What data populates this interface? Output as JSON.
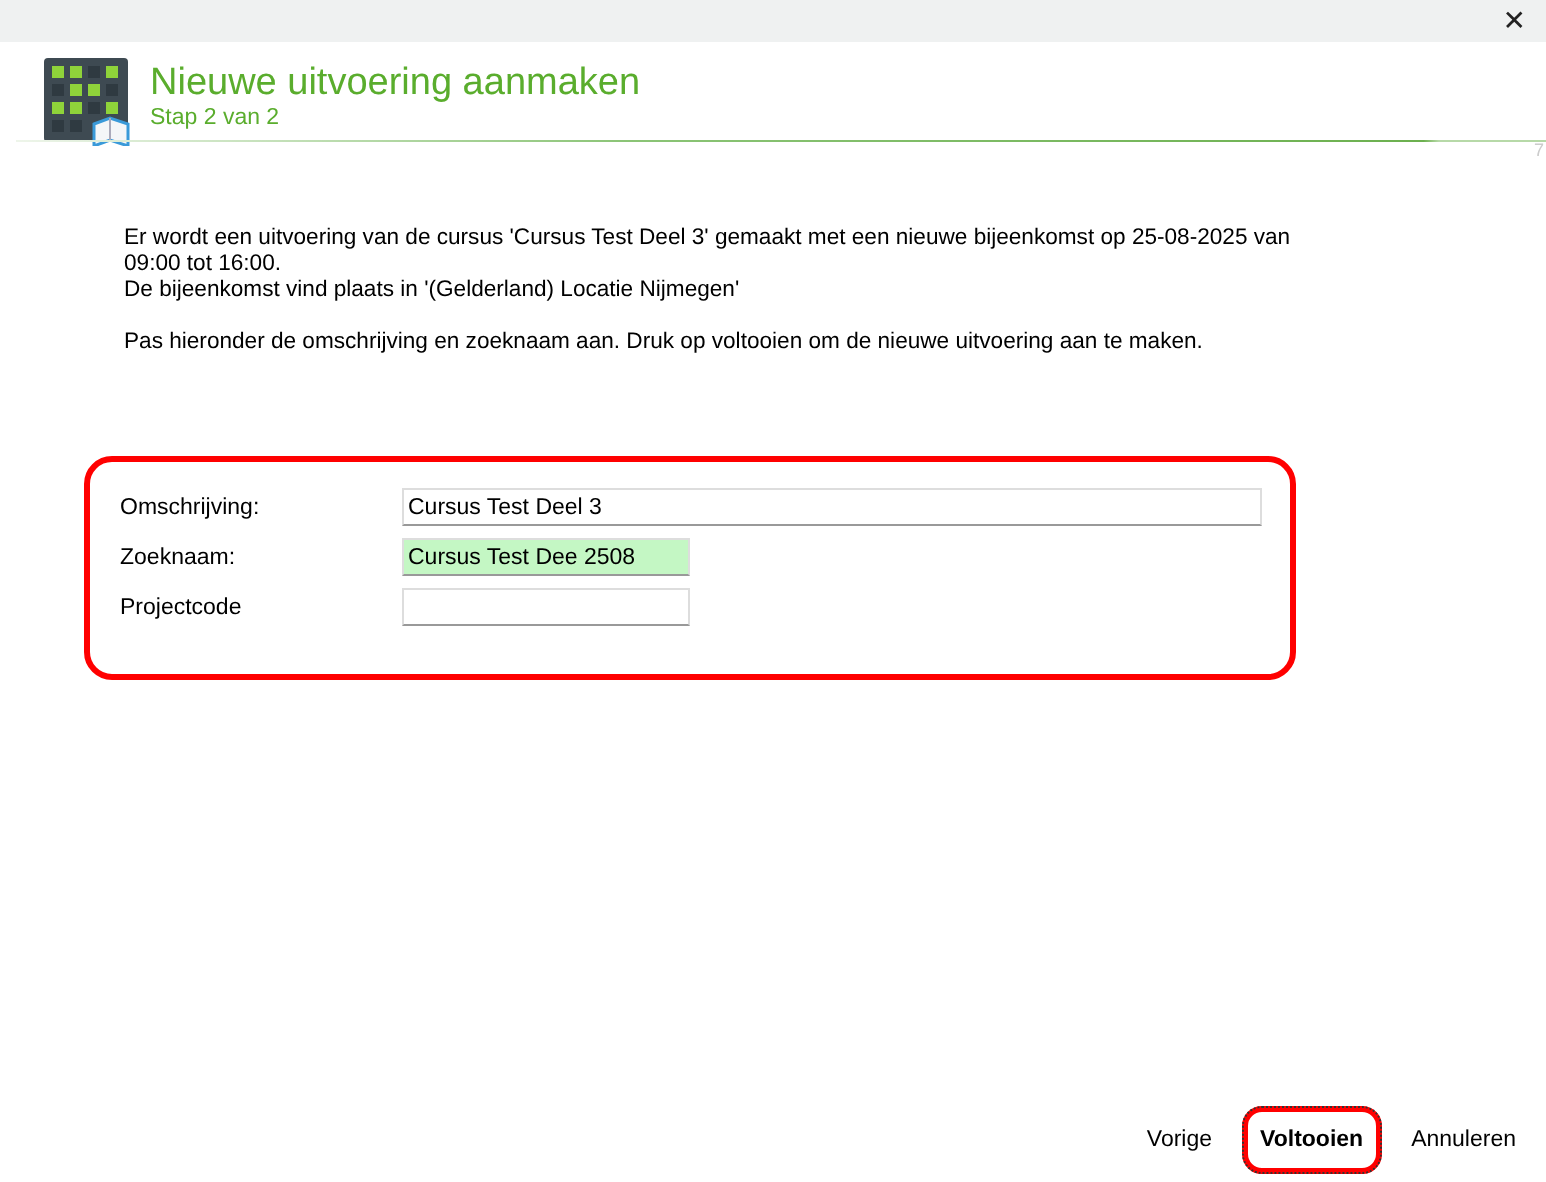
{
  "window": {
    "close": "✕",
    "corner_mark": "7"
  },
  "header": {
    "title": "Nieuwe uitvoering aanmaken",
    "subtitle": "Stap 2 van 2"
  },
  "intro": [
    "Er wordt een uitvoering van de cursus 'Cursus Test Deel 3' gemaakt met een nieuwe bijeenkomst op 25-08-2025 van 09:00 tot 16:00.",
    "De bijeenkomst vind plaats in '(Gelderland) Locatie Nijmegen'",
    "Pas hieronder de omschrijving en zoeknaam aan. Druk op voltooien om de nieuwe uitvoering aan te maken."
  ],
  "form": {
    "highlighted": true,
    "fields": [
      {
        "label": "Omschrijving:",
        "value": "Cursus Test Deel 3",
        "kind": "wide",
        "valid": false
      },
      {
        "label": "Zoeknaam:",
        "value": "Cursus Test Dee 2508",
        "kind": "short",
        "valid": true
      },
      {
        "label": "Projectcode",
        "kind": "short",
        "valid": false
      }
    ]
  },
  "buttons": [
    {
      "label": "Vorige",
      "default": false,
      "highlighted": false
    },
    {
      "label": "Voltooien",
      "default": true,
      "highlighted": true
    },
    {
      "label": "Annuleren",
      "default": false,
      "highlighted": false
    }
  ]
}
